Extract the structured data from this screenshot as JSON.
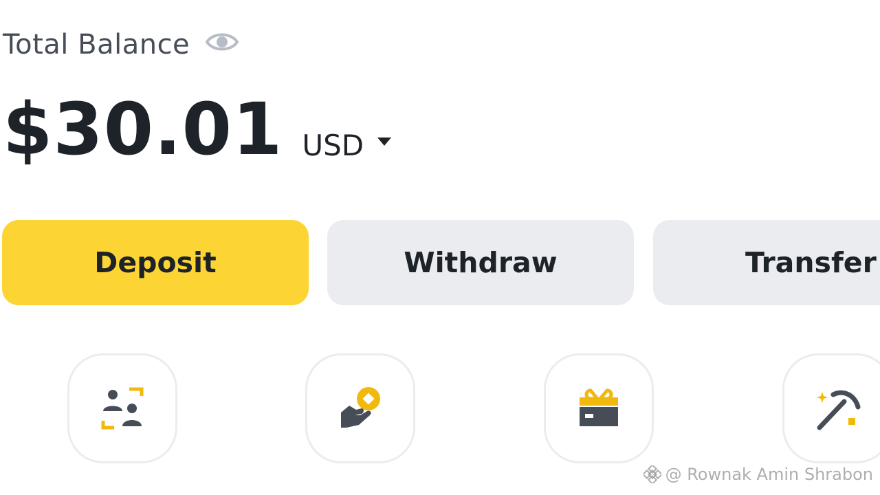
{
  "balance": {
    "label": "Total Balance",
    "amount": "$30.01",
    "currency": "USD"
  },
  "actions": {
    "deposit": "Deposit",
    "withdraw": "Withdraw",
    "transfer": "Transfer"
  },
  "shortcuts": [
    {
      "icon": "p2p-icon",
      "label": ""
    },
    {
      "icon": "earn-icon",
      "label": ""
    },
    {
      "icon": "gift-card-icon",
      "label": ""
    },
    {
      "icon": "mining-icon",
      "label": ""
    }
  ],
  "watermark": {
    "text": "@ Rownak Amin Shrabon"
  },
  "colors": {
    "accent": "#fcd535",
    "button_gray": "#eaecef",
    "text_dark": "#1e2329",
    "icon_dark": "#474d57",
    "icon_accent": "#f0b90b"
  }
}
